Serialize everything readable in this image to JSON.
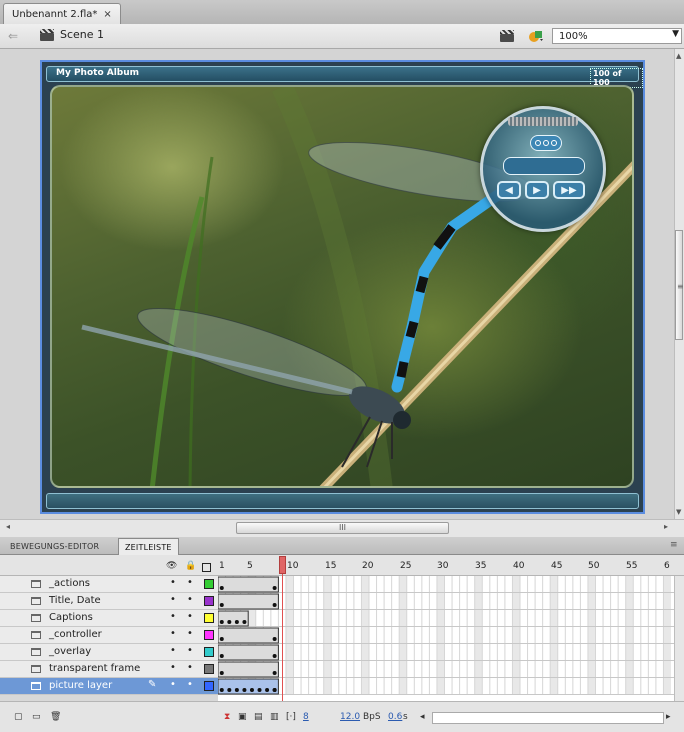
{
  "document": {
    "tab_title": "Unbenannt 2.fla*",
    "close_glyph": "×"
  },
  "scene": {
    "label": "Scene 1",
    "zoom": "100%"
  },
  "stage": {
    "album_title": "My Photo Album",
    "counter": "100 of 100",
    "hscroll_grip": "III"
  },
  "panel": {
    "tabs": [
      {
        "label": "BEWEGUNGS-EDITOR"
      },
      {
        "label": "ZEITLEISTE"
      }
    ]
  },
  "timeline": {
    "frame_numbers": [
      "1",
      "5",
      "10",
      "15",
      "20",
      "25",
      "30",
      "35",
      "40",
      "45",
      "50",
      "55",
      "6"
    ],
    "playhead_frame": 9,
    "layers": [
      {
        "name": "_actions",
        "color": "#33cc33",
        "selected": false
      },
      {
        "name": "Title, Date",
        "color": "#9933cc",
        "selected": false
      },
      {
        "name": "Captions",
        "color": "#ffff33",
        "selected": false
      },
      {
        "name": "_controller",
        "color": "#ff33ff",
        "selected": false
      },
      {
        "name": "_overlay",
        "color": "#33cccc",
        "selected": false
      },
      {
        "name": "transparent frame",
        "color": "#777777",
        "selected": false
      },
      {
        "name": "picture layer",
        "color": "#3366ff",
        "selected": true
      }
    ],
    "status": {
      "current_frame": "8",
      "fps": "12.0",
      "fps_unit": "BpS",
      "elapsed": "0.6",
      "elapsed_unit": "s"
    }
  },
  "colors": {
    "selection": "#6d98d6",
    "stage_border": "#5b8de0",
    "playhead": "#e05050"
  }
}
